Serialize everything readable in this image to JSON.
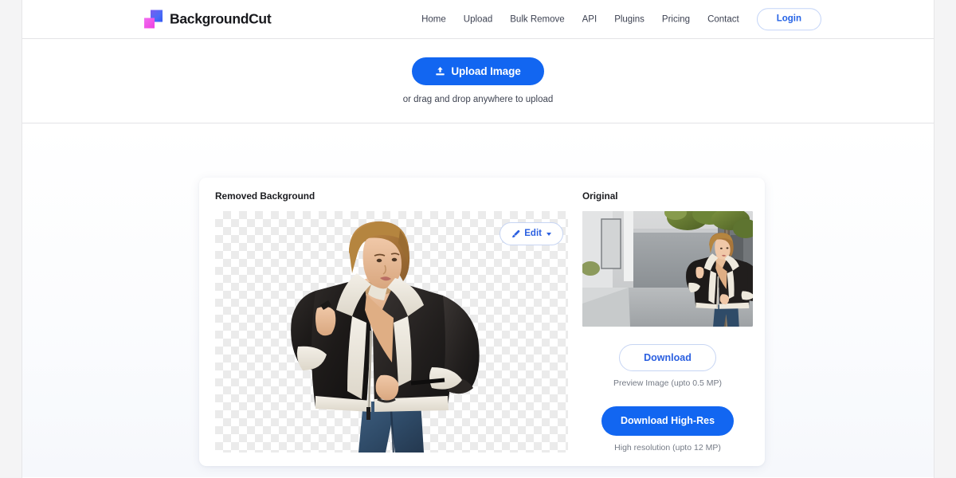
{
  "brand": {
    "name": "BackgroundCut",
    "logo_icon": "overlapping-squares-icon",
    "colors": {
      "blue": "#4a6cf7",
      "pink": "#ee3fe0"
    }
  },
  "header": {
    "nav": [
      {
        "label": "Home",
        "name": "nav-home"
      },
      {
        "label": "Upload",
        "name": "nav-upload"
      },
      {
        "label": "Bulk Remove",
        "name": "nav-bulk-remove"
      },
      {
        "label": "API",
        "name": "nav-api"
      },
      {
        "label": "Plugins",
        "name": "nav-plugins"
      },
      {
        "label": "Pricing",
        "name": "nav-pricing"
      },
      {
        "label": "Contact",
        "name": "nav-contact"
      }
    ],
    "login_label": "Login"
  },
  "upload": {
    "button_label": "Upload Image",
    "button_icon": "upload-icon",
    "hint": "or drag and drop anywhere to upload",
    "accent_color": "#1266f1"
  },
  "result": {
    "left_title": "Removed Background",
    "right_title": "Original",
    "edit_label": "Edit",
    "edit_icon": "brush-icon",
    "edit_caret_icon": "caret-down-icon",
    "download_label": "Download",
    "download_note": "Preview Image (upto 0.5 MP)",
    "download_hires_label": "Download High-Res",
    "download_hires_note": "High resolution (upto 12 MP)"
  }
}
